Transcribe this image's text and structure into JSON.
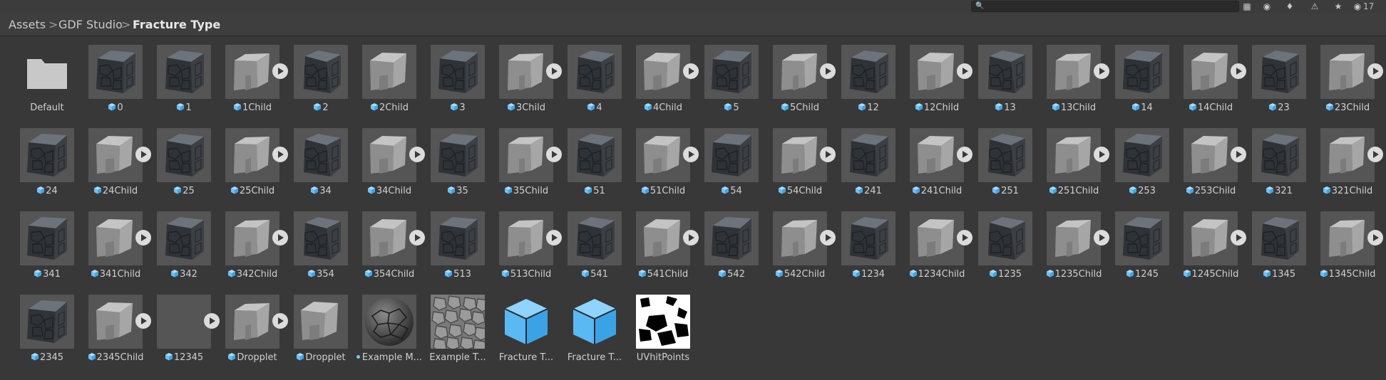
{
  "toolbar": {
    "search_placeholder": "",
    "icons": [
      "search-icon",
      "scene-icon",
      "type-filter-icon",
      "label-icon",
      "warning-icon",
      "favorite-icon",
      "eye-icon"
    ],
    "hidden_count": "17"
  },
  "breadcrumb": {
    "items": [
      "Assets",
      "GDF Studio"
    ],
    "separator": ">",
    "current": "Fracture Type"
  },
  "assets": [
    {
      "label": "Default",
      "kind": "folder"
    },
    {
      "label": "0",
      "kind": "prefab",
      "play": false,
      "style": "rock"
    },
    {
      "label": "1",
      "kind": "prefab",
      "play": false,
      "style": "rock"
    },
    {
      "label": "1Child",
      "kind": "prefab",
      "play": true,
      "style": "gray"
    },
    {
      "label": "2",
      "kind": "prefab",
      "play": false,
      "style": "rock"
    },
    {
      "label": "2Child",
      "kind": "prefab",
      "play": false,
      "style": "gray"
    },
    {
      "label": "3",
      "kind": "prefab",
      "play": false,
      "style": "rock"
    },
    {
      "label": "3Child",
      "kind": "prefab",
      "play": true,
      "style": "gray"
    },
    {
      "label": "4",
      "kind": "prefab",
      "play": false,
      "style": "rock"
    },
    {
      "label": "4Child",
      "kind": "prefab",
      "play": true,
      "style": "gray"
    },
    {
      "label": "5",
      "kind": "prefab",
      "play": false,
      "style": "rock"
    },
    {
      "label": "5Child",
      "kind": "prefab",
      "play": true,
      "style": "gray"
    },
    {
      "label": "12",
      "kind": "prefab",
      "play": false,
      "style": "rock"
    },
    {
      "label": "12Child",
      "kind": "prefab",
      "play": true,
      "style": "gray"
    },
    {
      "label": "13",
      "kind": "prefab",
      "play": false,
      "style": "rock"
    },
    {
      "label": "13Child",
      "kind": "prefab",
      "play": true,
      "style": "gray"
    },
    {
      "label": "14",
      "kind": "prefab",
      "play": false,
      "style": "rock"
    },
    {
      "label": "14Child",
      "kind": "prefab",
      "play": true,
      "style": "gray"
    },
    {
      "label": "23",
      "kind": "prefab",
      "play": false,
      "style": "rock"
    },
    {
      "label": "23Child",
      "kind": "prefab",
      "play": true,
      "style": "gray"
    },
    {
      "label": "24",
      "kind": "prefab",
      "play": false,
      "style": "rock"
    },
    {
      "label": "24Child",
      "kind": "prefab",
      "play": true,
      "style": "gray"
    },
    {
      "label": "25",
      "kind": "prefab",
      "play": false,
      "style": "rock"
    },
    {
      "label": "25Child",
      "kind": "prefab",
      "play": true,
      "style": "gray"
    },
    {
      "label": "34",
      "kind": "prefab",
      "play": false,
      "style": "rock"
    },
    {
      "label": "34Child",
      "kind": "prefab",
      "play": true,
      "style": "gray"
    },
    {
      "label": "35",
      "kind": "prefab",
      "play": false,
      "style": "rock"
    },
    {
      "label": "35Child",
      "kind": "prefab",
      "play": true,
      "style": "gray"
    },
    {
      "label": "51",
      "kind": "prefab",
      "play": false,
      "style": "rock"
    },
    {
      "label": "51Child",
      "kind": "prefab",
      "play": true,
      "style": "gray"
    },
    {
      "label": "54",
      "kind": "prefab",
      "play": false,
      "style": "rock"
    },
    {
      "label": "54Child",
      "kind": "prefab",
      "play": true,
      "style": "gray"
    },
    {
      "label": "241",
      "kind": "prefab",
      "play": false,
      "style": "rock"
    },
    {
      "label": "241Child",
      "kind": "prefab",
      "play": true,
      "style": "gray"
    },
    {
      "label": "251",
      "kind": "prefab",
      "play": false,
      "style": "rock"
    },
    {
      "label": "251Child",
      "kind": "prefab",
      "play": true,
      "style": "gray"
    },
    {
      "label": "253",
      "kind": "prefab",
      "play": false,
      "style": "rock"
    },
    {
      "label": "253Child",
      "kind": "prefab",
      "play": true,
      "style": "gray"
    },
    {
      "label": "321",
      "kind": "prefab",
      "play": false,
      "style": "rock"
    },
    {
      "label": "321Child",
      "kind": "prefab",
      "play": true,
      "style": "gray"
    },
    {
      "label": "341",
      "kind": "prefab",
      "play": false,
      "style": "rock"
    },
    {
      "label": "341Child",
      "kind": "prefab",
      "play": true,
      "style": "gray"
    },
    {
      "label": "342",
      "kind": "prefab",
      "play": false,
      "style": "rock"
    },
    {
      "label": "342Child",
      "kind": "prefab",
      "play": true,
      "style": "gray"
    },
    {
      "label": "354",
      "kind": "prefab",
      "play": false,
      "style": "rock"
    },
    {
      "label": "354Child",
      "kind": "prefab",
      "play": true,
      "style": "gray"
    },
    {
      "label": "513",
      "kind": "prefab",
      "play": false,
      "style": "rock"
    },
    {
      "label": "513Child",
      "kind": "prefab",
      "play": true,
      "style": "gray"
    },
    {
      "label": "541",
      "kind": "prefab",
      "play": false,
      "style": "rock"
    },
    {
      "label": "541Child",
      "kind": "prefab",
      "play": true,
      "style": "gray"
    },
    {
      "label": "542",
      "kind": "prefab",
      "play": false,
      "style": "rock"
    },
    {
      "label": "542Child",
      "kind": "prefab",
      "play": true,
      "style": "gray"
    },
    {
      "label": "1234",
      "kind": "prefab",
      "play": false,
      "style": "rock"
    },
    {
      "label": "1234Child",
      "kind": "prefab",
      "play": true,
      "style": "gray"
    },
    {
      "label": "1235",
      "kind": "prefab",
      "play": false,
      "style": "rock"
    },
    {
      "label": "1235Child",
      "kind": "prefab",
      "play": true,
      "style": "gray"
    },
    {
      "label": "1245",
      "kind": "prefab",
      "play": false,
      "style": "rock"
    },
    {
      "label": "1245Child",
      "kind": "prefab",
      "play": true,
      "style": "gray"
    },
    {
      "label": "1345",
      "kind": "prefab",
      "play": false,
      "style": "rock"
    },
    {
      "label": "1345Child",
      "kind": "prefab",
      "play": true,
      "style": "gray"
    },
    {
      "label": "2345",
      "kind": "prefab",
      "play": false,
      "style": "rock"
    },
    {
      "label": "2345Child",
      "kind": "prefab",
      "play": true,
      "style": "gray"
    },
    {
      "label": "12345",
      "kind": "prefab",
      "play": true,
      "style": "empty"
    },
    {
      "label": "Dropplet",
      "kind": "prefab",
      "play": true,
      "style": "gray"
    },
    {
      "label": "Dropplet",
      "kind": "prefab",
      "play": false,
      "style": "gray"
    },
    {
      "label": "Example M...",
      "kind": "material",
      "style": "sphere"
    },
    {
      "label": "Example T...",
      "kind": "texture",
      "style": "stones"
    },
    {
      "label": "Fracture T...",
      "kind": "script-object",
      "style": "cube"
    },
    {
      "label": "Fracture T...",
      "kind": "script-object",
      "style": "cube"
    },
    {
      "label": "UVhitPoints",
      "kind": "texture",
      "style": "uvpoints"
    }
  ],
  "colors": {
    "background": "#383838",
    "prefab_icon": "#7ac6f6",
    "thumb_bg": "#555555",
    "play_badge": "#dcdcdc"
  }
}
